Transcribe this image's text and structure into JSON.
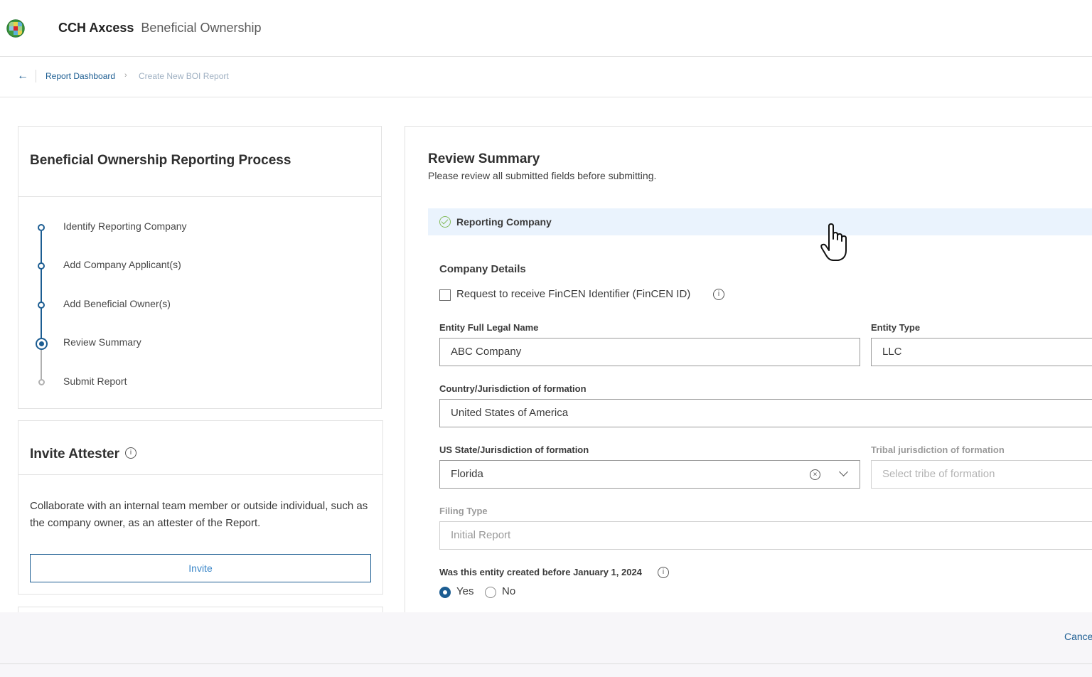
{
  "header": {
    "brand": "CCH Axcess",
    "product": "Beneficial Ownership",
    "logo_icon": "wolters-kluwer-globe-logo"
  },
  "breadcrumb": {
    "back_icon": "arrow-left-icon",
    "items": [
      {
        "label": "Report Dashboard",
        "link": true
      },
      {
        "label": "Create New BOI Report",
        "link": false
      }
    ],
    "separator": "›"
  },
  "process": {
    "title": "Beneficial Ownership Reporting Process",
    "steps": [
      {
        "label": "Identify Reporting Company",
        "state": "complete"
      },
      {
        "label": "Add Company Applicant(s)",
        "state": "complete"
      },
      {
        "label": "Add Beneficial Owner(s)",
        "state": "complete"
      },
      {
        "label": "Review Summary",
        "state": "current"
      },
      {
        "label": "Submit Report",
        "state": "upcoming"
      }
    ]
  },
  "attester": {
    "title": "Invite Attester",
    "info_icon": "ⓘ",
    "description": "Collaborate with an internal team member or outside individual, such as the company owner, as an attester of the Report.",
    "invite_label": "Invite"
  },
  "review": {
    "title": "Review Summary",
    "subtitle": "Please review all submitted fields before submitting.",
    "section": {
      "label": "Reporting Company",
      "status": "complete"
    },
    "company_details": {
      "title": "Company Details",
      "fincen_checkbox": {
        "label": "Request to receive FinCEN Identifier (FinCEN ID)",
        "checked": false
      },
      "info_icon": "i",
      "fields": {
        "legal_name": {
          "label": "Entity Full Legal Name",
          "value": "ABC Company"
        },
        "entity_type": {
          "label": "Entity Type",
          "value": "LLC"
        },
        "country": {
          "label": "Country/Jurisdiction of formation",
          "value": "United States of America"
        },
        "us_state": {
          "label": "US State/Jurisdiction of formation",
          "value": "Florida",
          "clear_icon": "×"
        },
        "tribal": {
          "label": "Tribal jurisdiction of formation",
          "placeholder": "Select tribe of formation"
        },
        "filing_type": {
          "label": "Filing Type",
          "value": "Initial Report"
        }
      },
      "created_before": {
        "label": "Was this entity created before January 1, 2024",
        "options": [
          {
            "label": "Yes",
            "selected": true
          },
          {
            "label": "No",
            "selected": false
          }
        ]
      }
    }
  },
  "footer": {
    "cancel_label": "Cancel"
  },
  "colors": {
    "accent": "#1c5d92",
    "section_bg": "#eaf3fd",
    "success": "#84bb5a",
    "footer_bg": "#f7f6f9"
  }
}
